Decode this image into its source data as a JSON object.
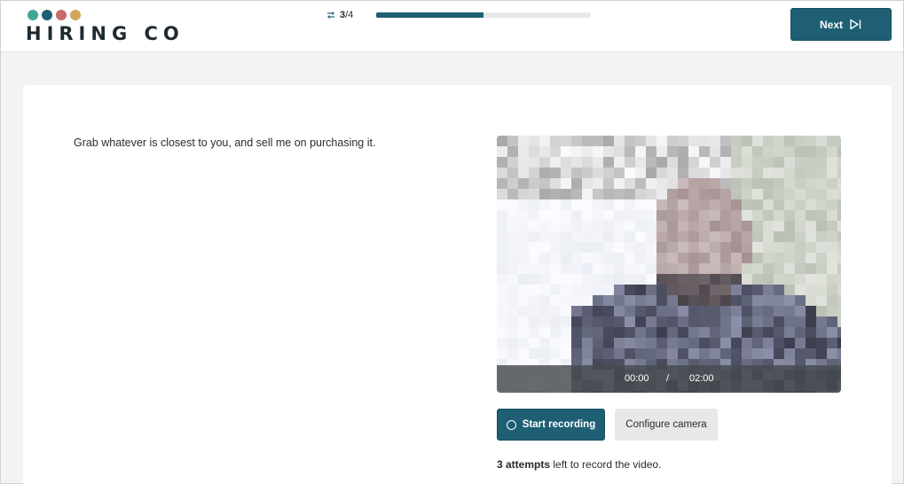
{
  "brand": {
    "name": "HIRING CO",
    "dot_colors": [
      "#3fa79a",
      "#1e5f74",
      "#c86b6b",
      "#d1a85a"
    ]
  },
  "progress": {
    "current": "3",
    "total": "/4",
    "fill_fraction": 0.5,
    "icon": "repeat-icon"
  },
  "header": {
    "next_label": "Next",
    "next_icon": "skip-forward-icon"
  },
  "question": {
    "text": "Grab whatever is closest to you, and sell me on purchasing it."
  },
  "video": {
    "current_time": "00:00",
    "separator": "/",
    "duration": "02:00"
  },
  "actions": {
    "start_recording_label": "Start recording",
    "start_recording_icon": "circle-record-icon",
    "configure_camera_label": "Configure camera"
  },
  "attempts": {
    "count_text": "3 attempts",
    "suffix_text": " left to record the video."
  },
  "colors": {
    "accent": "#1e5f74",
    "background": "#f2f3f4"
  }
}
